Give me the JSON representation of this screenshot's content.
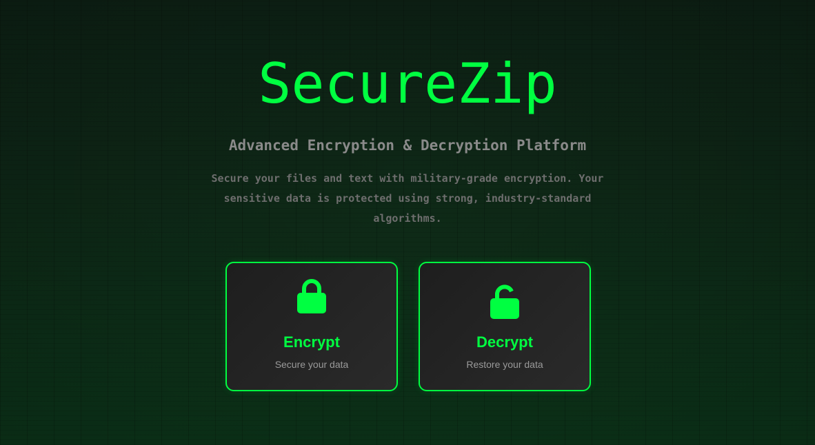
{
  "hero": {
    "title": "SecureZip",
    "subtitle": "Advanced Encryption & Decryption Platform",
    "description": "Secure your files and text with military-grade encryption. Your sensitive data is protected using strong, industry-standard algorithms."
  },
  "actions": [
    {
      "label": "Encrypt",
      "sublabel": "Secure your data",
      "icon": "lock-closed-icon"
    },
    {
      "label": "Decrypt",
      "sublabel": "Restore your data",
      "icon": "lock-open-icon"
    }
  ],
  "colors": {
    "accent": "#00ff41",
    "background": "#0f2a18",
    "card_background": "#232323",
    "subtitle_text": "#8a8a8a",
    "description_text": "#6e6e6e"
  }
}
